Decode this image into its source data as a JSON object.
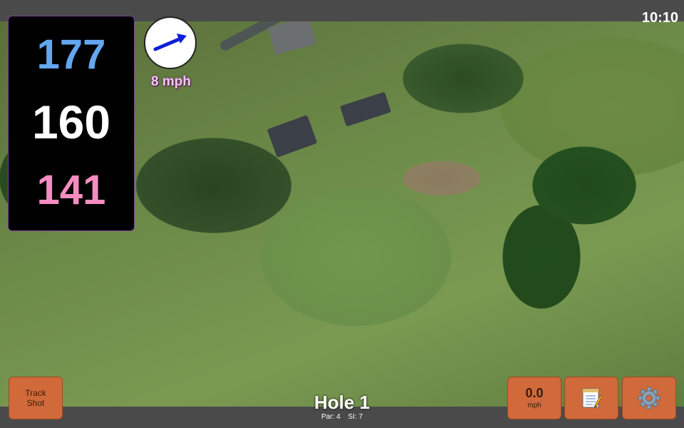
{
  "status_bar": {
    "time": "10:10"
  },
  "distances": {
    "back": "177",
    "middle": "160",
    "front": "141",
    "colors": {
      "back": "#62a7f0",
      "middle": "#ffffff",
      "front": "#f58cc0"
    }
  },
  "wind": {
    "speed": "8 mph",
    "direction_icon": "arrow-icon",
    "arrow_color": "#0d1fd8"
  },
  "hole": {
    "title": "Hole 1",
    "par": "Par: 4",
    "si": "SI: 7"
  },
  "buttons": {
    "track_shot_line1": "Track",
    "track_shot_line2": "Shot",
    "speed_value": "0.0",
    "speed_unit": "mph",
    "notes_icon": "notepad-icon",
    "settings_icon": "gear-icon",
    "color": "#d06a3a"
  }
}
